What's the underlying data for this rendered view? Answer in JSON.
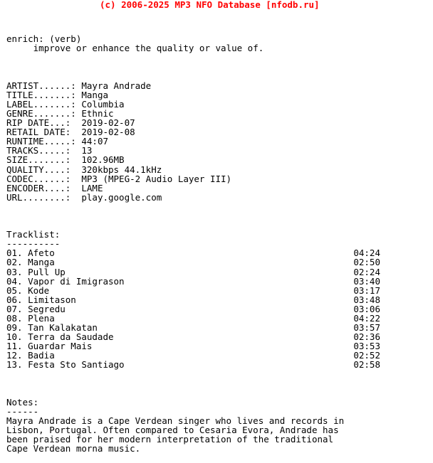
{
  "header": {
    "copyright": "(c) 2006-2025 MP3 NFO Database [nfodb.ru]",
    "color": "#ff0000"
  },
  "definition": {
    "term": "enrich: (verb)",
    "meaning": "improve or enhance the quality or value of."
  },
  "metadata": {
    "rows": [
      {
        "label": "ARTIST......:",
        "value": "Mayra Andrade"
      },
      {
        "label": "TITLE.......:",
        "value": "Manga"
      },
      {
        "label": "LABEL.......:",
        "value": "Columbia"
      },
      {
        "label": "GENRE.......:",
        "value": "Ethnic"
      },
      {
        "label": "RIP DATE...:",
        "value": "2019-02-07"
      },
      {
        "label": "RETAIL DATE:",
        "value": "2019-02-08"
      },
      {
        "label": "RUNTIME.....:",
        "value": "44:07"
      },
      {
        "label": "TRACKS.....:",
        "value": "13"
      },
      {
        "label": "SIZE.......:",
        "value": "102.96MB"
      },
      {
        "label": "QUALITY....:",
        "value": "320kbps 44.1kHz"
      },
      {
        "label": "CODEC......:",
        "value": "MP3 (MPEG-2 Audio Layer III)"
      },
      {
        "label": "ENCODER....:",
        "value": "LAME"
      },
      {
        "label": "URL........:",
        "value": "play.google.com"
      }
    ]
  },
  "tracklist": {
    "heading": "Tracklist:",
    "underline": "----------",
    "tracks": [
      {
        "num": "01.",
        "title": "Afeto",
        "duration": "04:24"
      },
      {
        "num": "02.",
        "title": "Manga",
        "duration": "02:50"
      },
      {
        "num": "03.",
        "title": "Pull Up",
        "duration": "02:24"
      },
      {
        "num": "04.",
        "title": "Vapor di Imigrason",
        "duration": "03:40"
      },
      {
        "num": "05.",
        "title": "Kode",
        "duration": "03:17"
      },
      {
        "num": "06.",
        "title": "Limitason",
        "duration": "03:48"
      },
      {
        "num": "07.",
        "title": "Segredu",
        "duration": "03:06"
      },
      {
        "num": "08.",
        "title": "Plena",
        "duration": "04:22"
      },
      {
        "num": "09.",
        "title": "Tan Kalakatan",
        "duration": "03:57"
      },
      {
        "num": "10.",
        "title": "Terra da Saudade",
        "duration": "02:36"
      },
      {
        "num": "11.",
        "title": "Guardar Mais",
        "duration": "03:53"
      },
      {
        "num": "12.",
        "title": "Badia",
        "duration": "02:52"
      },
      {
        "num": "13.",
        "title": "Festa Sto Santiago",
        "duration": "02:58"
      }
    ]
  },
  "notes": {
    "heading": "Notes:",
    "underline": "------",
    "lines": [
      "Mayra Andrade is a Cape Verdean singer who lives and records in",
      "Lisbon, Portugal. Often compared to Cesaria Evora, Andrade has",
      "been praised for her modern interpretation of the traditional",
      "Cape Verdean morna music."
    ]
  }
}
